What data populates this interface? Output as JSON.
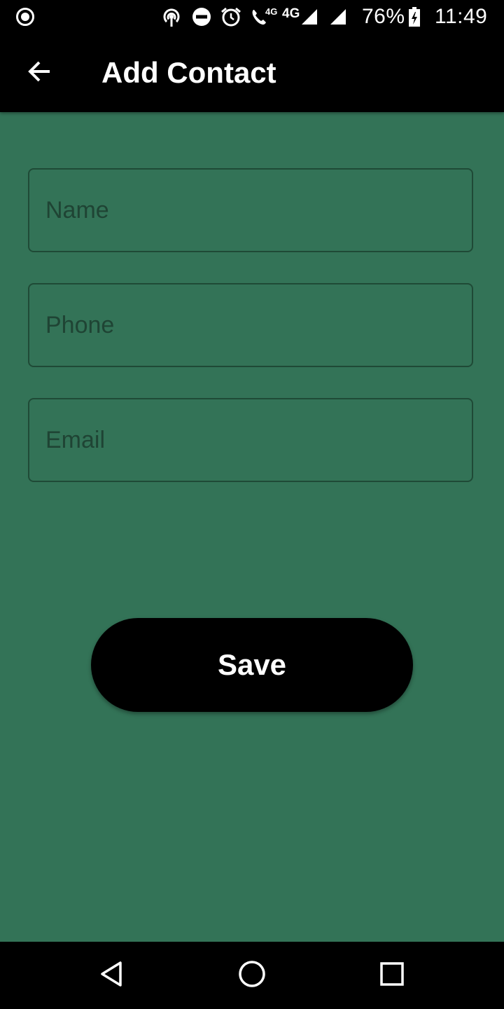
{
  "status_bar": {
    "left_icons": [
      "record-icon"
    ],
    "right_icons": [
      "hotspot-icon",
      "do-not-disturb-icon",
      "alarm-icon",
      "volte-call-icon",
      "signal-4g-icon",
      "signal-icon",
      "battery-charging-icon"
    ],
    "volte_label": "4G",
    "network_label": "4G",
    "battery_percent": "76%",
    "battery_level": 0.76,
    "time": "11:49"
  },
  "app_bar": {
    "back_icon": "arrow-back-icon",
    "title": "Add Contact"
  },
  "form": {
    "fields": [
      {
        "name": "name",
        "placeholder": "Name",
        "value": ""
      },
      {
        "name": "phone",
        "placeholder": "Phone",
        "value": ""
      },
      {
        "name": "email",
        "placeholder": "Email",
        "value": ""
      }
    ],
    "save_label": "Save"
  },
  "nav_bar": {
    "icons": [
      "nav-back-icon",
      "nav-home-icon",
      "nav-recents-icon"
    ]
  },
  "colors": {
    "background": "#337357",
    "app_bar": "#000000",
    "button": "#000000",
    "field_border": "#1f4a36",
    "placeholder": "#1f4434"
  }
}
